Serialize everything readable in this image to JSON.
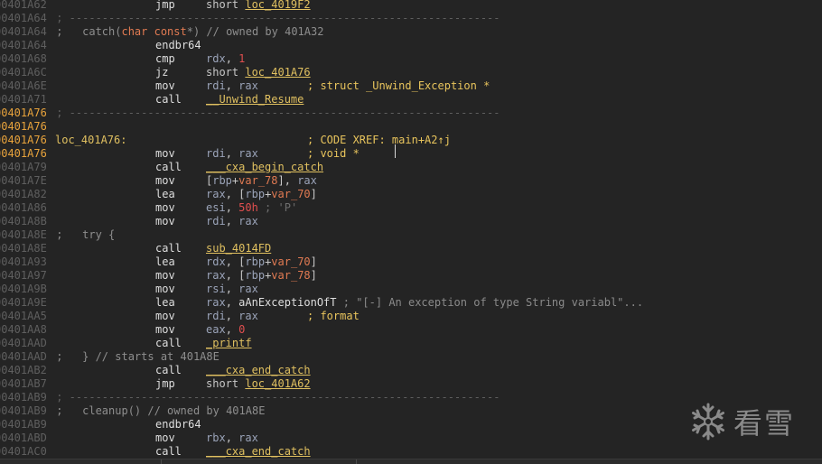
{
  "code_lines": [
    {
      "addr": "00401A62",
      "hl": false,
      "mn": "jmp",
      "ops": [
        {
          "t": "short "
        },
        {
          "c": "sym",
          "t": "loc_4019F2"
        }
      ]
    },
    {
      "addr": "00401A64",
      "hl": false,
      "rule": " ; ------------------------------------------------------------------"
    },
    {
      "addr": "00401A64",
      "hl": false,
      "comment": [
        {
          "t": " ;   catch("
        },
        {
          "c": "kw",
          "t": "char const"
        },
        {
          "t": "*) // owned by 401A32"
        }
      ]
    },
    {
      "addr": "00401A64",
      "hl": false,
      "mn": "endbr64"
    },
    {
      "addr": "00401A68",
      "hl": false,
      "mn": "cmp",
      "ops": [
        {
          "c": "reg",
          "t": "rdx"
        },
        {
          "t": ", "
        },
        {
          "c": "num",
          "t": "1"
        }
      ]
    },
    {
      "addr": "00401A6C",
      "hl": false,
      "mn": "jz",
      "ops": [
        {
          "t": "short "
        },
        {
          "c": "sym",
          "t": "loc_401A76"
        }
      ]
    },
    {
      "addr": "00401A6E",
      "hl": false,
      "mn": "mov",
      "ops": [
        {
          "c": "reg",
          "t": "rdi"
        },
        {
          "t": ", "
        },
        {
          "c": "reg",
          "t": "rax"
        }
      ],
      "tc": "; struct _Unwind_Exception *"
    },
    {
      "addr": "00401A71",
      "hl": false,
      "mn": "call",
      "ops": [
        {
          "c": "sym",
          "t": "__Unwind_Resume"
        }
      ]
    },
    {
      "addr": "00401A76",
      "hl": true,
      "rule": " ; ------------------------------------------------------------------"
    },
    {
      "addr": "00401A76",
      "hl": true
    },
    {
      "addr": "00401A76",
      "hl": true,
      "label": "loc_401A76:",
      "tc": "; CODE XREF: main+A2↑j"
    },
    {
      "addr": "00401A76",
      "hl": true,
      "mn": "mov",
      "ops": [
        {
          "c": "reg",
          "t": "rdi"
        },
        {
          "t": ", "
        },
        {
          "c": "reg",
          "t": "rax"
        }
      ],
      "tc": "; void *"
    },
    {
      "addr": "00401A79",
      "hl": false,
      "mn": "call",
      "ops": [
        {
          "c": "sym",
          "t": "___cxa_begin_catch"
        }
      ]
    },
    {
      "addr": "00401A7E",
      "hl": false,
      "mn": "mov",
      "ops": [
        {
          "t": "["
        },
        {
          "c": "reg",
          "t": "rbp"
        },
        {
          "t": "+"
        },
        {
          "c": "var",
          "t": "var_78"
        },
        {
          "t": "], "
        },
        {
          "c": "reg",
          "t": "rax"
        }
      ]
    },
    {
      "addr": "00401A82",
      "hl": false,
      "mn": "lea",
      "ops": [
        {
          "c": "reg",
          "t": "rax"
        },
        {
          "t": ", ["
        },
        {
          "c": "reg",
          "t": "rbp"
        },
        {
          "t": "+"
        },
        {
          "c": "var",
          "t": "var_70"
        },
        {
          "t": "]"
        }
      ]
    },
    {
      "addr": "00401A86",
      "hl": false,
      "mn": "mov",
      "ops": [
        {
          "c": "reg",
          "t": "esi"
        },
        {
          "t": ", "
        },
        {
          "c": "num",
          "t": "50h"
        },
        {
          "c": "strc",
          "t": " ; 'P'"
        }
      ]
    },
    {
      "addr": "00401A8B",
      "hl": false,
      "mn": "mov",
      "ops": [
        {
          "c": "reg",
          "t": "rdi"
        },
        {
          "t": ", "
        },
        {
          "c": "reg",
          "t": "rax"
        }
      ]
    },
    {
      "addr": "00401A8E",
      "hl": false,
      "comment": [
        {
          "t": " ;   try {"
        }
      ]
    },
    {
      "addr": "00401A8E",
      "hl": false,
      "mn": "call",
      "ops": [
        {
          "c": "sym",
          "t": "sub_4014FD"
        }
      ]
    },
    {
      "addr": "00401A93",
      "hl": false,
      "mn": "lea",
      "ops": [
        {
          "c": "reg",
          "t": "rdx"
        },
        {
          "t": ", ["
        },
        {
          "c": "reg",
          "t": "rbp"
        },
        {
          "t": "+"
        },
        {
          "c": "var",
          "t": "var_70"
        },
        {
          "t": "]"
        }
      ]
    },
    {
      "addr": "00401A97",
      "hl": false,
      "mn": "mov",
      "ops": [
        {
          "c": "reg",
          "t": "rax"
        },
        {
          "t": ", ["
        },
        {
          "c": "reg",
          "t": "rbp"
        },
        {
          "t": "+"
        },
        {
          "c": "var",
          "t": "var_78"
        },
        {
          "t": "]"
        }
      ]
    },
    {
      "addr": "00401A9B",
      "hl": false,
      "mn": "mov",
      "ops": [
        {
          "c": "reg",
          "t": "rsi"
        },
        {
          "t": ", "
        },
        {
          "c": "reg",
          "t": "rax"
        }
      ]
    },
    {
      "addr": "00401A9E",
      "hl": false,
      "mn": "lea",
      "ops": [
        {
          "c": "reg",
          "t": "rax"
        },
        {
          "t": ", "
        },
        {
          "c": "kwop",
          "t": "aAnExceptionOfT"
        },
        {
          "c": "str",
          "t": " ; \"[-] An exception of type String variabl\"..."
        }
      ]
    },
    {
      "addr": "00401AA5",
      "hl": false,
      "mn": "mov",
      "ops": [
        {
          "c": "reg",
          "t": "rdi"
        },
        {
          "t": ", "
        },
        {
          "c": "reg",
          "t": "rax"
        }
      ],
      "tc": "; format"
    },
    {
      "addr": "00401AA8",
      "hl": false,
      "mn": "mov",
      "ops": [
        {
          "c": "reg",
          "t": "eax"
        },
        {
          "t": ", "
        },
        {
          "c": "num",
          "t": "0"
        }
      ]
    },
    {
      "addr": "00401AAD",
      "hl": false,
      "mn": "call",
      "ops": [
        {
          "c": "sym",
          "t": "_printf"
        }
      ]
    },
    {
      "addr": "00401AAD",
      "hl": false,
      "comment": [
        {
          "t": " ;   } // starts at 401A8E"
        }
      ]
    },
    {
      "addr": "00401AB2",
      "hl": false,
      "mn": "call",
      "ops": [
        {
          "c": "sym",
          "t": "___cxa_end_catch"
        }
      ]
    },
    {
      "addr": "00401AB7",
      "hl": false,
      "mn": "jmp",
      "ops": [
        {
          "t": "short "
        },
        {
          "c": "sym",
          "t": "loc_401A62"
        }
      ]
    },
    {
      "addr": "00401AB9",
      "hl": false,
      "rule": " ; ------------------------------------------------------------------"
    },
    {
      "addr": "00401AB9",
      "hl": false,
      "comment": [
        {
          "t": " ;   cleanup() // owned by 401A8E"
        }
      ]
    },
    {
      "addr": "00401AB9",
      "hl": false,
      "mn": "endbr64"
    },
    {
      "addr": "00401ABD",
      "hl": false,
      "mn": "mov",
      "ops": [
        {
          "c": "reg",
          "t": "rbx"
        },
        {
          "t": ", "
        },
        {
          "c": "reg",
          "t": "rax"
        }
      ]
    },
    {
      "addr": "00401AC0",
      "hl": false,
      "mn": "call",
      "ops": [
        {
          "c": "sym",
          "t": "___cxa_end_catch"
        }
      ]
    }
  ],
  "watermark": {
    "text": "看雪",
    "icon": "snowflake-icon"
  },
  "colors": {
    "background": "#242424",
    "address": "#5f5f5f",
    "address_highlight": "#e8a33c",
    "symbol": "#e0c060",
    "register": "#9aa3b8",
    "number": "#e04f4f",
    "variable": "#e07a52"
  }
}
